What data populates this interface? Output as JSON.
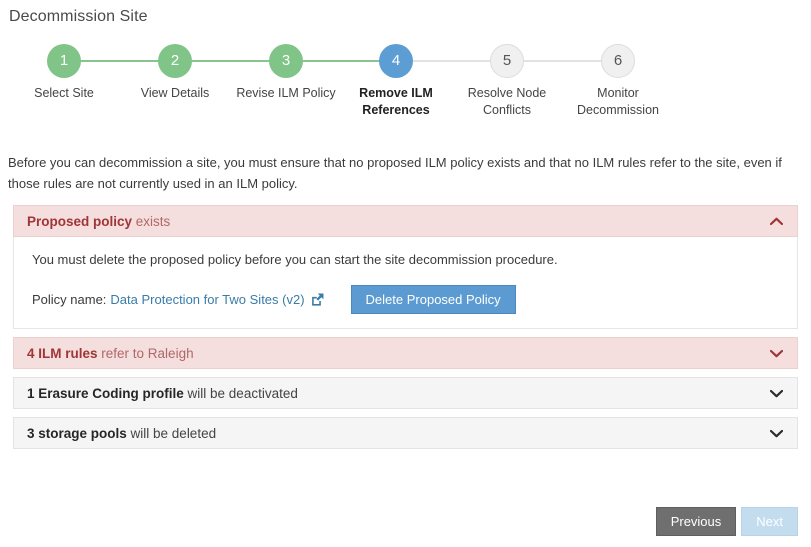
{
  "page": {
    "title": "Decommission Site"
  },
  "stepper": {
    "steps": [
      {
        "number": "1",
        "label": "Select Site",
        "state": "done"
      },
      {
        "number": "2",
        "label": "View Details",
        "state": "done"
      },
      {
        "number": "3",
        "label": "Revise ILM Policy",
        "state": "done"
      },
      {
        "number": "4",
        "label": "Remove ILM References",
        "state": "active"
      },
      {
        "number": "5",
        "label": "Resolve Node Conflicts",
        "state": "todo"
      },
      {
        "number": "6",
        "label": "Monitor Decommission",
        "state": "todo"
      }
    ]
  },
  "intro": {
    "text": "Before you can decommission a site, you must ensure that no proposed ILM policy exists and that no ILM rules refer to the site, even if those rules are not currently used in an ILM policy."
  },
  "panels": [
    {
      "strong": "Proposed policy",
      "rest": " exists",
      "tone": "danger",
      "expanded": true,
      "chevron": "chevron-up-icon",
      "body": {
        "text": "You must delete the proposed policy before you can start the site decommission procedure.",
        "policy_label": "Policy name:",
        "policy_link": "Data Protection for Two Sites (v2)",
        "link_icon": "external-link-icon",
        "button": "Delete Proposed Policy"
      }
    },
    {
      "strong": "4 ILM rules",
      "rest": " refer to Raleigh",
      "tone": "danger",
      "expanded": false,
      "chevron": "chevron-down-icon"
    },
    {
      "strong": "1 Erasure Coding profile",
      "rest": " will be deactivated",
      "tone": "neutral",
      "expanded": false,
      "chevron": "chevron-down-icon"
    },
    {
      "strong": "3 storage pools",
      "rest": " will be deleted",
      "tone": "neutral",
      "expanded": false,
      "chevron": "chevron-down-icon"
    }
  ],
  "footer": {
    "previous": "Previous",
    "next": "Next"
  },
  "colors": {
    "step_done": "#80c488",
    "step_active": "#5c9ed3",
    "step_todo": "#f0f0f0",
    "danger_bg": "#f5dede",
    "danger_text": "#a33f3f",
    "link": "#3a7ca8",
    "primary_button": "#5b9bd1",
    "previous_button": "#6f6f6f",
    "next_button_disabled": "#c3ddef"
  }
}
